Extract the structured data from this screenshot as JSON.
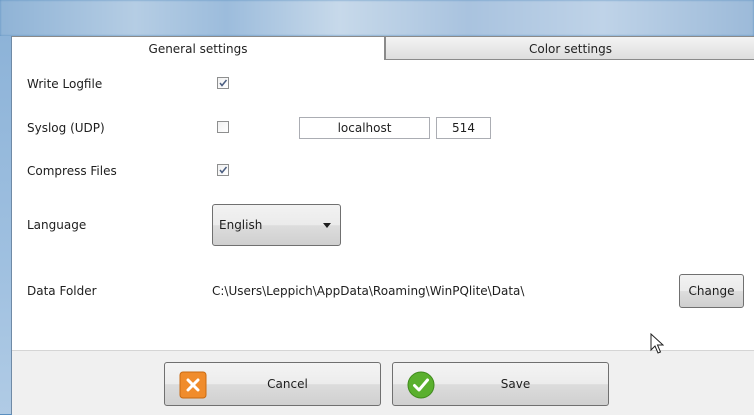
{
  "tabs": [
    {
      "label": "General settings",
      "selected": true
    },
    {
      "label": "Color settings",
      "selected": false
    }
  ],
  "settings": {
    "write_logfile": {
      "label": "Write Logfile",
      "checked": true
    },
    "syslog": {
      "label": "Syslog (UDP)",
      "checked": false,
      "host": "localhost",
      "port": "514"
    },
    "compress_files": {
      "label": "Compress Files",
      "checked": true
    },
    "language": {
      "label": "Language",
      "value": "English"
    },
    "data_folder": {
      "label": "Data Folder",
      "path": "C:\\Users\\Leppich\\AppData\\Roaming\\WinPQlite\\Data\\",
      "change_label": "Change"
    }
  },
  "footer": {
    "cancel_label": "Cancel",
    "save_label": "Save"
  },
  "icons": {
    "cancel": "close-x-icon",
    "save": "checkmark-icon",
    "dropdown": "triangle-down-icon",
    "cursor": "mouse-pointer-icon"
  },
  "colors": {
    "cancel_icon": "#f08c2c",
    "save_icon": "#5ab02e",
    "titlebar": "#a9c3df"
  }
}
